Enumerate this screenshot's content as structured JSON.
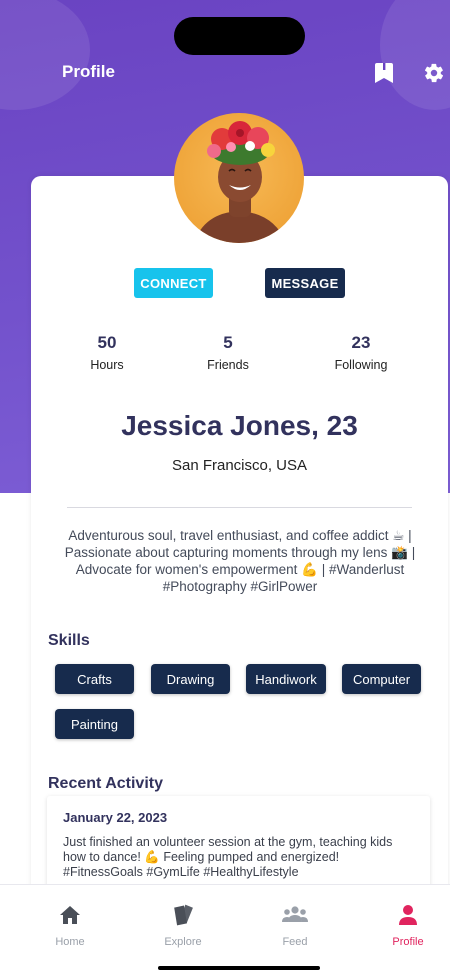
{
  "header": {
    "title": "Profile",
    "bookmark_icon": "bookmark-icon",
    "settings_icon": "gear-icon"
  },
  "theme": {
    "hero_color": "#6a43c2",
    "connect_color": "#17c3ec",
    "primary_dark": "#172b4d",
    "active_tab_color": "#e0245e"
  },
  "actions": {
    "connect_label": "CONNECT",
    "message_label": "MESSAGE"
  },
  "stats": [
    {
      "value": "50",
      "label": "Hours"
    },
    {
      "value": "5",
      "label": "Friends"
    },
    {
      "value": "23",
      "label": "Following"
    }
  ],
  "profile": {
    "name": "Jessica Jones, 23",
    "location": "San Francisco, USA",
    "bio": "Adventurous soul, travel enthusiast, and coffee addict ☕ | Passionate about capturing moments through my lens 📸 | Advocate for women's empowerment 💪 | #Wanderlust #Photography #GirlPower"
  },
  "skills": {
    "title": "Skills",
    "items": [
      "Crafts",
      "Drawing",
      "Handiwork",
      "Computer",
      "Painting"
    ]
  },
  "activity": {
    "title": "Recent Activity",
    "items": [
      {
        "date": "January 22, 2023",
        "text": "Just finished an volunteer session at the gym, teaching kids how to dance! 💪 Feeling pumped and energized! #FitnessGoals #GymLife #HealthyLifestyle"
      }
    ]
  },
  "tabs": [
    {
      "label": "Home",
      "icon": "home-icon",
      "active": false
    },
    {
      "label": "Explore",
      "icon": "cards-icon",
      "active": false
    },
    {
      "label": "Feed",
      "icon": "users-icon",
      "active": false
    },
    {
      "label": "Profile",
      "icon": "user-icon",
      "active": true
    }
  ]
}
